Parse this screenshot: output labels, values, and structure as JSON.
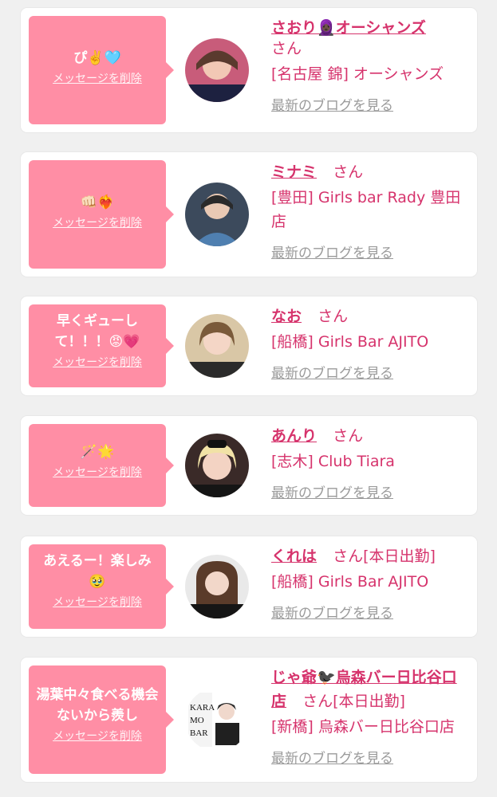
{
  "ui": {
    "delete_label": "メッセージを削除",
    "san_label": "さん",
    "blog_label": "最新のブログを見る"
  },
  "cards": [
    {
      "message": "ぴ✌️🩵",
      "name": "さおり🧕🏿オーシャンズ",
      "shop": "[名古屋 錦] オーシャンズ",
      "status": ""
    },
    {
      "message": "👊🏻❤️‍🔥",
      "name": "ミナミ",
      "shop": "[豊田] Girls bar Rady 豊田店",
      "status": ""
    },
    {
      "message": "早くギューして！！！😡💗",
      "name": "なお",
      "shop": "[船橋] Girls Bar AJITO",
      "status": ""
    },
    {
      "message": "🪄🌟",
      "name": "あんり",
      "shop": "[志木] Club Tiara",
      "status": ""
    },
    {
      "message": "あえるー！楽しみ🥹",
      "name": "くれは",
      "shop": "[船橋] Girls Bar AJITO",
      "status": "[本日出勤]"
    },
    {
      "message": "湯葉中々食べる機会ないから羨し",
      "name": "じゃ爺🐦‍⬛烏森バー日比谷口店",
      "shop": "[新橋] 烏森バー日比谷口店",
      "status": "[本日出勤]"
    }
  ],
  "colors": {
    "accent": "#d6336c",
    "bubble": "#ff8ea5",
    "background": "#f0f0f0",
    "link_gray": "#9a9a9a"
  }
}
